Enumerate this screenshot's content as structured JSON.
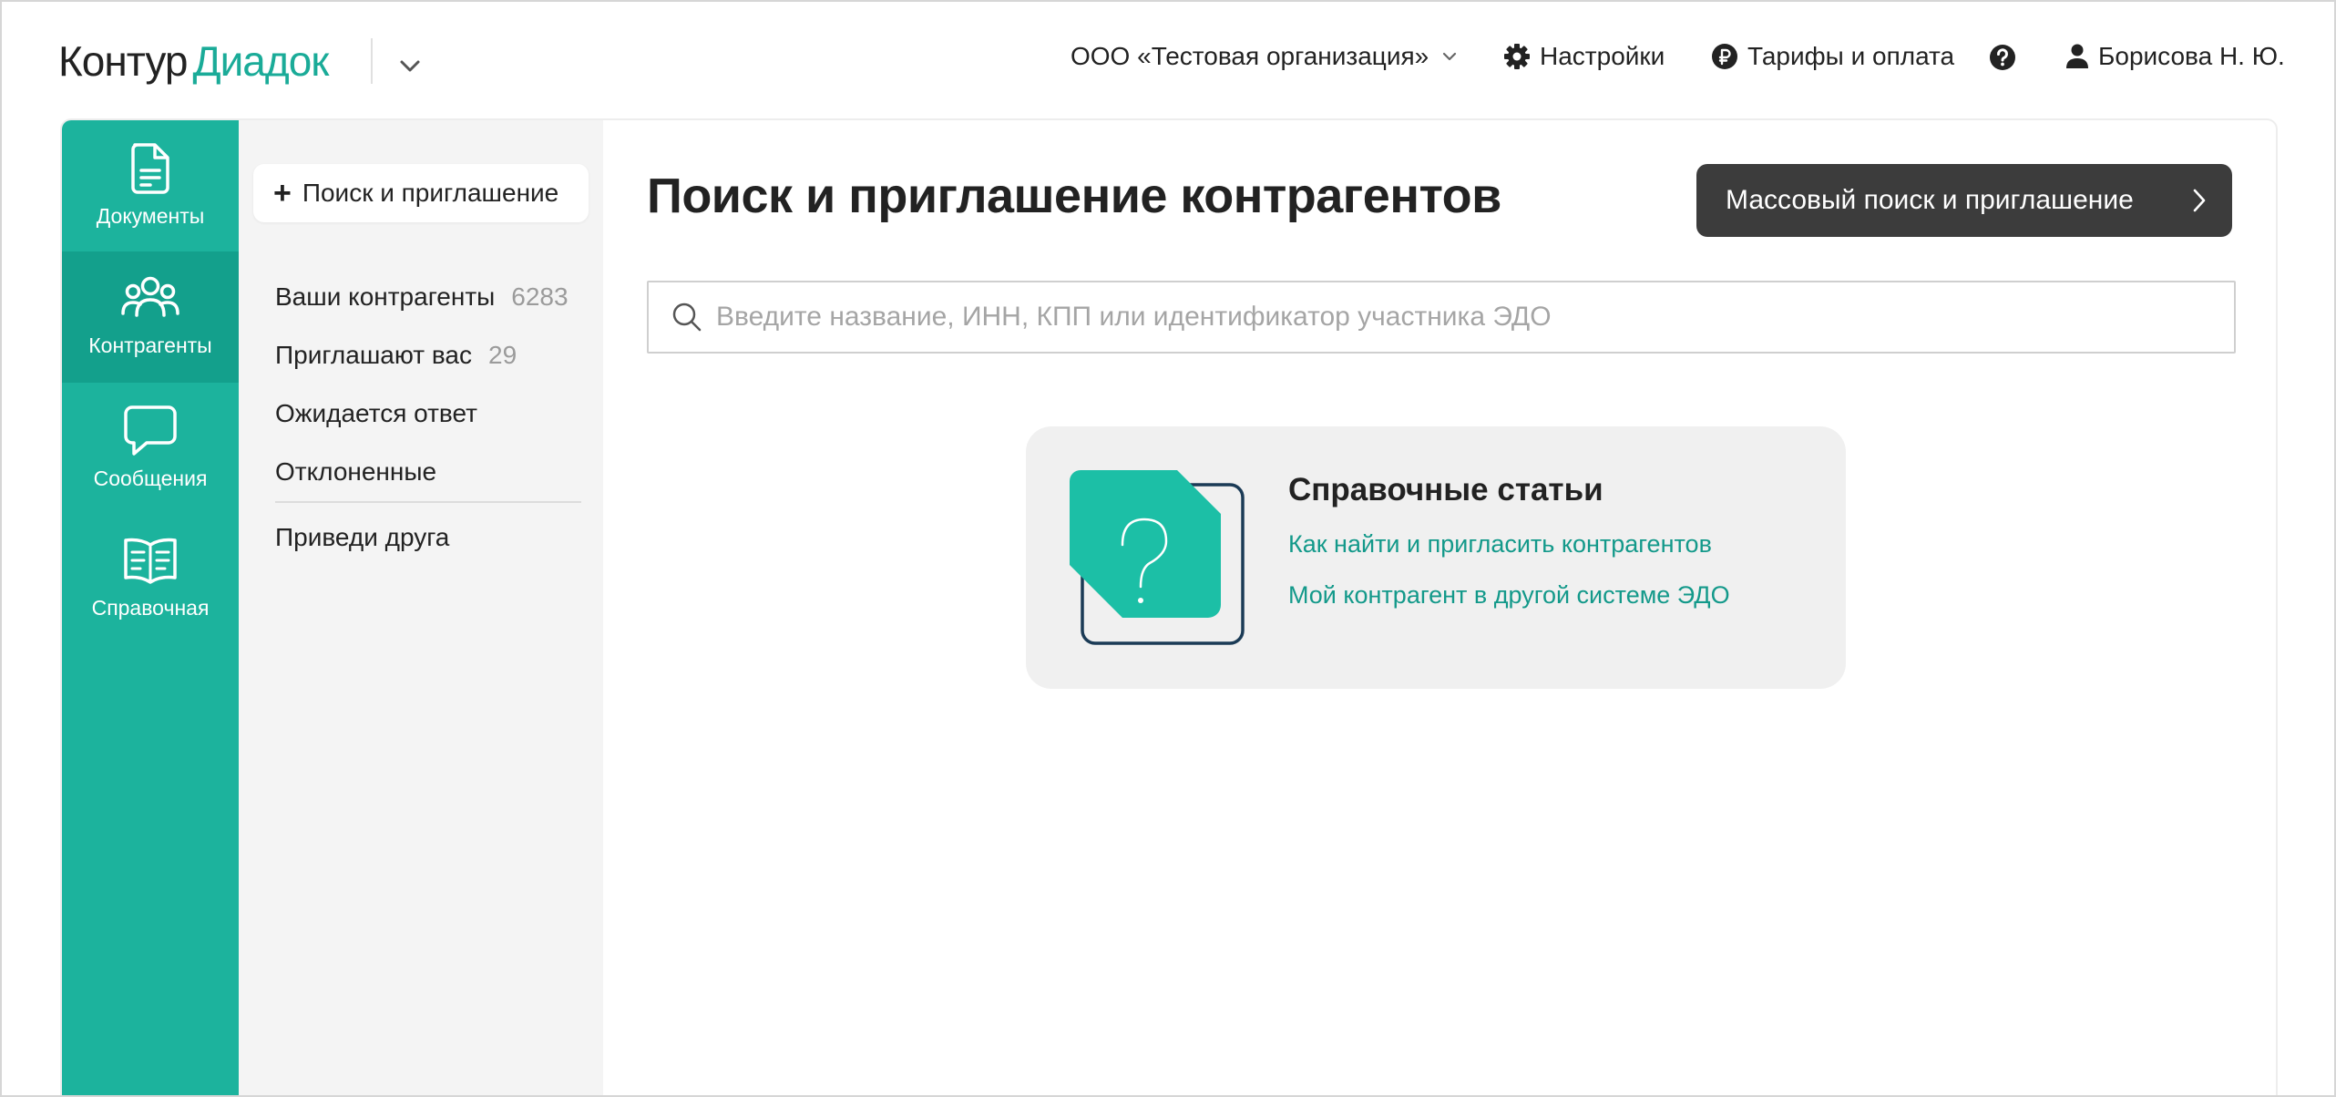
{
  "header": {
    "logo_primary": "Контур",
    "logo_secondary": "Диадок",
    "organization": "ООО «Тестовая организация»",
    "settings_label": "Настройки",
    "tariffs_label": "Тарифы и оплата",
    "user_name": "Борисова Н. Ю."
  },
  "rail": {
    "items": [
      {
        "label": "Документы",
        "icon": "document-icon"
      },
      {
        "label": "Контрагенты",
        "icon": "people-icon",
        "active": true
      },
      {
        "label": "Сообщения",
        "icon": "chat-icon"
      },
      {
        "label": "Справочная",
        "icon": "book-icon"
      }
    ]
  },
  "subnav": {
    "search_button_label": "Поиск и приглашение",
    "items": [
      {
        "label": "Ваши контрагенты",
        "count": "6283"
      },
      {
        "label": "Приглашают вас",
        "count": "29"
      },
      {
        "label": "Ожидается ответ"
      },
      {
        "label": "Отклоненные"
      }
    ],
    "refer_friend": "Приведи друга"
  },
  "main": {
    "title": "Поиск и приглашение контрагентов",
    "mass_button_label": "Массовый поиск и приглашение",
    "search_placeholder": "Введите название, ИНН, КПП или идентификатор участника ЭДО",
    "help_card": {
      "title": "Справочные статьи",
      "links": [
        "Как найти и пригласить контрагентов",
        "Мой контрагент в другой системе ЭДО"
      ]
    }
  },
  "colors": {
    "accent": "#1cb39d",
    "accent_active": "#13a08c",
    "link": "#13998a",
    "dark_button": "#3c3c3c"
  }
}
